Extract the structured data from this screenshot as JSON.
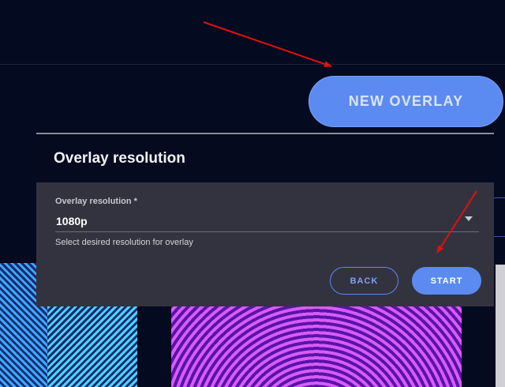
{
  "header": {
    "new_overlay_label": "NEW OVERLAY"
  },
  "panel": {
    "title": "Overlay resolution"
  },
  "dialog": {
    "field_label": "Overlay resolution *",
    "selected_value": "1080p",
    "helper_text": "Select desired resolution for overlay",
    "back_label": "BACK",
    "start_label": "START"
  },
  "colors": {
    "background": "#040a1f",
    "accent": "#5b8bf0",
    "dialog_bg": "#33333f",
    "annotation_arrow": "#e01010"
  },
  "icons": {
    "dropdown": "chevron-down-icon",
    "annotations": "arrow-icon"
  }
}
